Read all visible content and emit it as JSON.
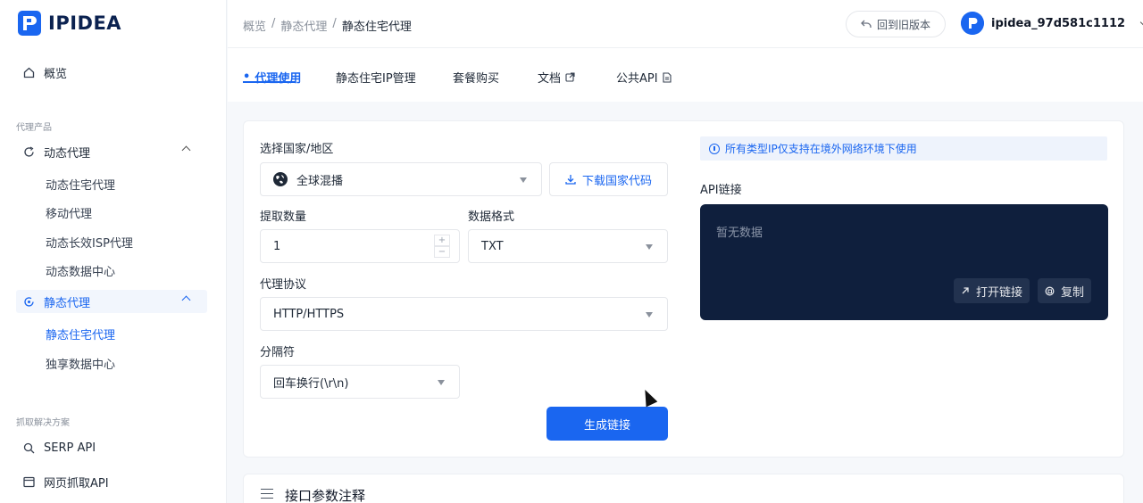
{
  "app": {
    "brand": "IPIDEA"
  },
  "sidebar": {
    "overview": "概览",
    "group_products": "代理产品",
    "dynamic": {
      "label": "动态代理",
      "items": [
        "动态住宅代理",
        "移动代理",
        "动态长效ISP代理",
        "动态数据中心"
      ]
    },
    "static": {
      "label": "静态代理",
      "items": [
        "静态住宅代理",
        "独享数据中心"
      ],
      "active_item": "静态住宅代理"
    },
    "group_scraping": "抓取解决方案",
    "serp": "SERP API",
    "web_scraper": "网页抓取API"
  },
  "header": {
    "breadcrumb": [
      "概览",
      "/",
      "静态代理",
      "/",
      "静态住宅代理"
    ],
    "back_button": "回到旧版本",
    "username": "ipidea_97d581c1112"
  },
  "tabs": [
    {
      "label": "代理使用",
      "active": true
    },
    {
      "label": "静态住宅IP管理"
    },
    {
      "label": "套餐购买"
    },
    {
      "label": "文档",
      "icon": "external-link-icon"
    },
    {
      "label": "公共API",
      "icon": "document-icon"
    }
  ],
  "form": {
    "country_label": "选择国家/地区",
    "country_value": "全球混播",
    "download_button": "下载国家代码",
    "quantity_label": "提取数量",
    "quantity_value": "1",
    "format_label": "数据格式",
    "format_value": "TXT",
    "protocol_label": "代理协议",
    "protocol_value": "HTTP/HTTPS",
    "separator_label": "分隔符",
    "separator_value": "回车换行(\\r\\n)",
    "generate_button": "生成链接"
  },
  "api": {
    "notice": "所有类型IP仅支持在境外网络环境下使用",
    "label": "API链接",
    "empty": "暂无数据",
    "open_button": "打开链接",
    "copy_button": "复制"
  },
  "params": {
    "title": "接口参数注释"
  },
  "colors": {
    "accent": "#1a66f0",
    "dark_panel": "#0f1f3d"
  }
}
